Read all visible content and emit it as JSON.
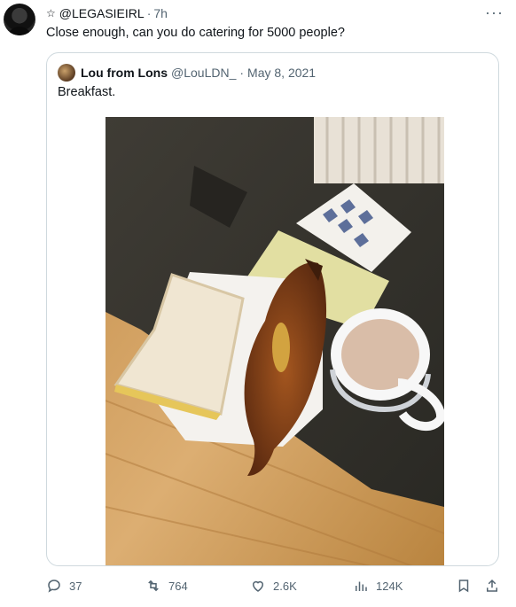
{
  "tweet": {
    "handle": "@LEGASIEIRL",
    "separator": "·",
    "time": "7h",
    "text": "Close enough, can you do catering for 5000 people?",
    "more_label": "···"
  },
  "quote": {
    "name": "Lou from Lons",
    "handle": "@LouLDN_",
    "separator": "·",
    "date": "May 8, 2021",
    "text": "Breakfast."
  },
  "actions": {
    "replies": "37",
    "reposts": "764",
    "likes": "2.6K",
    "views": "124K"
  },
  "icons": {
    "star": "star-icon",
    "more": "more-icon",
    "reply": "reply-icon",
    "repost": "repost-icon",
    "like": "heart-icon",
    "views": "views-icon",
    "bookmark": "bookmark-icon",
    "share": "share-icon"
  },
  "colors": {
    "text": "#0f1419",
    "muted": "#536471",
    "border": "#cfd9de"
  }
}
